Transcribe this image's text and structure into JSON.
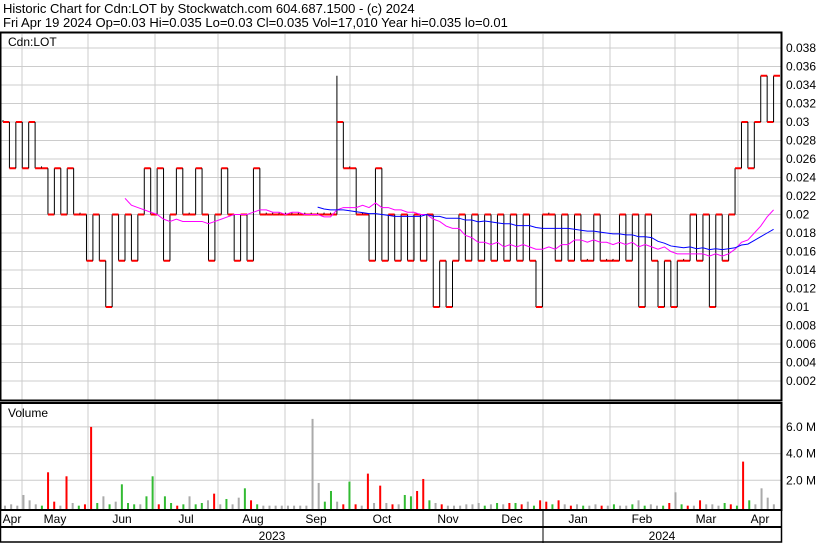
{
  "header": {
    "title": "Historic Chart for Cdn:LOT by Stockwatch.com 604.687.1500 - (c) 2024",
    "quote": "Fri Apr 19 2024  Op=0.03  Hi=0.035  Lo=0.03  Cl=0.035  Vol=17,010  Year hi=0.035  lo=0.01"
  },
  "chart_data": [
    {
      "type": "line",
      "title": "Cdn:LOT",
      "subtype": "ohlc-bars with moving averages",
      "ylim": [
        0,
        0.038
      ],
      "yticks": [
        "0.038",
        "0.036",
        "0.034",
        "0.032",
        "0.03",
        "0.028",
        "0.026",
        "0.024",
        "0.022",
        "0.02",
        "0.018",
        "0.016",
        "0.014",
        "0.012",
        "0.01",
        "0.008",
        "0.006",
        "0.004",
        "0.002"
      ],
      "closes": [
        0.03,
        0.025,
        0.03,
        0.025,
        0.03,
        0.025,
        0.025,
        0.02,
        0.025,
        0.02,
        0.025,
        0.02,
        0.02,
        0.015,
        0.02,
        0.015,
        0.01,
        0.02,
        0.015,
        0.02,
        0.015,
        0.02,
        0.025,
        0.02,
        0.025,
        0.015,
        0.02,
        0.025,
        0.02,
        0.02,
        0.025,
        0.02,
        0.015,
        0.02,
        0.025,
        0.02,
        0.015,
        0.02,
        0.015,
        0.025,
        0.02,
        0.02,
        0.02,
        0.02,
        0.02,
        0.02,
        0.02,
        0.02,
        0.02,
        0.02,
        0.02,
        0.02,
        0.03,
        0.025,
        0.025,
        0.02,
        0.02,
        0.015,
        0.025,
        0.015,
        0.02,
        0.015,
        0.02,
        0.015,
        0.02,
        0.015,
        0.02,
        0.01,
        0.015,
        0.01,
        0.015,
        0.02,
        0.015,
        0.02,
        0.015,
        0.02,
        0.015,
        0.02,
        0.015,
        0.02,
        0.015,
        0.02,
        0.015,
        0.01,
        0.02,
        0.02,
        0.015,
        0.02,
        0.015,
        0.02,
        0.015,
        0.015,
        0.02,
        0.015,
        0.015,
        0.015,
        0.02,
        0.015,
        0.02,
        0.01,
        0.02,
        0.015,
        0.01,
        0.015,
        0.01,
        0.015,
        0.015,
        0.02,
        0.015,
        0.02,
        0.01,
        0.02,
        0.015,
        0.02,
        0.025,
        0.03,
        0.025,
        0.03,
        0.035,
        0.03,
        0.035
      ],
      "spikes": {
        "52": 0.035
      },
      "ma_short": 20,
      "ma_long": 50,
      "colors": {
        "bar": "#000000",
        "close_tick": "#ff0000",
        "ma_short": "#ff00ff",
        "ma_long": "#0000ff"
      }
    },
    {
      "type": "bar",
      "title": "Volume",
      "ylim": [
        0,
        8
      ],
      "yticks": [
        "6.0 M",
        "4.0 M",
        "2.0 M"
      ],
      "values_millions": [
        0.1,
        0.2,
        0.1,
        0.9,
        0.5,
        0.2,
        0.1,
        2.6,
        0.4,
        0.1,
        2.3,
        0.3,
        0.1,
        0.2,
        6.0,
        0.3,
        0.8,
        0.2,
        0.4,
        1.7,
        0.3,
        0.2,
        0.2,
        0.8,
        2.3,
        0.2,
        0.8,
        0.3,
        0.1,
        0.2,
        0.8,
        0.2,
        0.3,
        0.5,
        1.0,
        0.2,
        0.6,
        0.2,
        0.7,
        1.4,
        0.5,
        0.2,
        0.1,
        0.1,
        0.1,
        0.1,
        0.1,
        0.1,
        0.1,
        0.1,
        6.6,
        1.8,
        0.4,
        1.2,
        0.4,
        0.2,
        1.9,
        0.2,
        0.1,
        2.5,
        0.3,
        1.6,
        0.3,
        0.2,
        0.2,
        0.9,
        0.8,
        1.2,
        2.1,
        0.5,
        0.3,
        0.2,
        0.1,
        0.1,
        0.1,
        0.2,
        0.2,
        0.3,
        0.1,
        0.2,
        0.3,
        0.2,
        0.3,
        0.3,
        0.2,
        0.4,
        0.1,
        0.5,
        0.4,
        0.2,
        0.5,
        0.2,
        0.1,
        0.2,
        0.1,
        0.1,
        0.2,
        0.1,
        0.1,
        0.2,
        0.1,
        0.1,
        0.2,
        0.5,
        0.1,
        0.2,
        0.1,
        0.1,
        0.3,
        1.1,
        0.2,
        0.1,
        0.1,
        0.5,
        0.2,
        0.2,
        0.1,
        0.3,
        0.2,
        0.1,
        3.4,
        0.5,
        0.2,
        1.4,
        0.7,
        0.2
      ],
      "directions": "ffffffuddfdfuddufufuuufuuduudufuufdfuffuduffffffffffuufdudfdfdfdfuuddufdffffffufufdudfuddudfdfuffdfuffufuffudfudfdfffududuf",
      "colors": {
        "up": "#33bb33",
        "down": "#ff0000",
        "flat": "#aaaaaa"
      }
    },
    {
      "type": "axis",
      "months": [
        "Apr",
        "May",
        "Jun",
        "Jul",
        "Aug",
        "Sep",
        "Oct",
        "Nov",
        "Dec",
        "Jan",
        "Feb",
        "Mar",
        "Apr"
      ],
      "years": [
        "2023",
        "2024"
      ]
    }
  ]
}
